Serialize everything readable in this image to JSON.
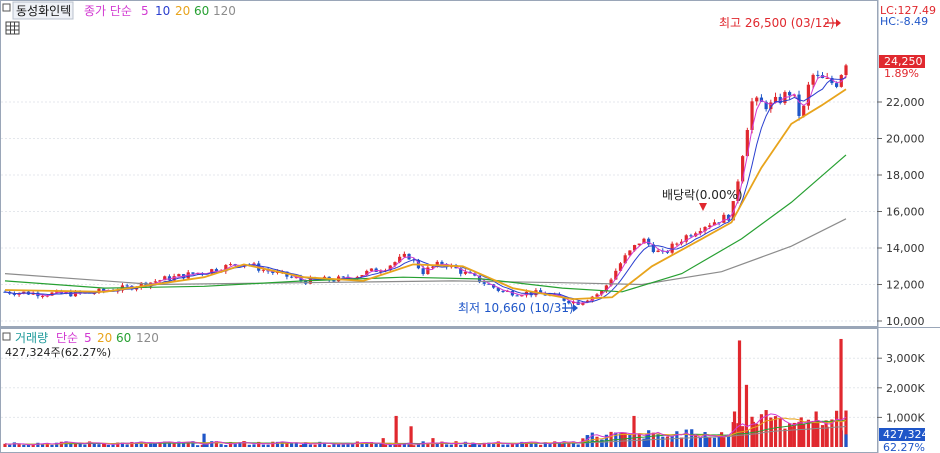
{
  "price_panel": {
    "stock_name": "동성화인텍",
    "indicator_label": "종가 단순",
    "ma_labels": [
      "5",
      "10",
      "20",
      "60",
      "120"
    ],
    "lc_text": "LC:127.49",
    "hc_text": "HC:-8.49",
    "high_annotation": "최고 26,500 (03/12)",
    "low_annotation": "최저 10,660 (10/31)",
    "dividend_annotation": "배당락(0.00%)",
    "current_price": "24,250",
    "change_pct": "1.89%"
  },
  "volume_panel": {
    "title": "거래량",
    "indicator_label": "단순",
    "ma_labels": [
      "5",
      "20",
      "60",
      "120"
    ],
    "volume_info": "427,324주(62.27%)",
    "current_volume": "427,324",
    "current_pct": "62.27%"
  },
  "colors": {
    "up": "#e0282e",
    "down": "#1f56c8",
    "ma5": "#d23ad2",
    "ma10": "#2a3fd0",
    "ma20": "#e8a41c",
    "ma60": "#27a032",
    "ma120": "#8c8c8c"
  },
  "chart_data": [
    {
      "type": "line",
      "title": "동성화인텍",
      "ylim": [
        10000,
        26500
      ],
      "y_ticks": [
        "10,000",
        "12,000",
        "14,000",
        "16,000",
        "18,000",
        "20,000",
        "22,000"
      ],
      "series": [
        {
          "name": "종가",
          "points": [
            [
              0,
              11600
            ],
            [
              40,
              11500
            ],
            [
              80,
              11500
            ],
            [
              120,
              11800
            ],
            [
              160,
              12300
            ],
            [
              200,
              12700
            ],
            [
              240,
              13200
            ],
            [
              260,
              12800
            ],
            [
              300,
              12200
            ],
            [
              340,
              12300
            ],
            [
              380,
              12900
            ],
            [
              405,
              13600
            ],
            [
              420,
              12700
            ],
            [
              440,
              13200
            ],
            [
              470,
              12400
            ],
            [
              500,
              11600
            ],
            [
              540,
              11500
            ],
            [
              575,
              11000
            ],
            [
              600,
              11600
            ],
            [
              620,
              13300
            ],
            [
              640,
              14500
            ],
            [
              660,
              13600
            ],
            [
              680,
              14500
            ],
            [
              700,
              15200
            ],
            [
              730,
              15800
            ],
            [
              750,
              22000
            ],
            [
              770,
              21800
            ],
            [
              790,
              22600
            ],
            [
              800,
              21000
            ],
            [
              810,
              23500
            ],
            [
              820,
              23200
            ],
            [
              835,
              23000
            ],
            [
              845,
              24250
            ]
          ]
        },
        {
          "name": "5",
          "points": []
        },
        {
          "name": "10",
          "points": []
        },
        {
          "name": "20",
          "points": [
            [
              0,
              11700
            ],
            [
              100,
              11600
            ],
            [
              200,
              12400
            ],
            [
              240,
              13100
            ],
            [
              300,
              12400
            ],
            [
              360,
              12200
            ],
            [
              410,
              13100
            ],
            [
              460,
              13000
            ],
            [
              510,
              11800
            ],
            [
              570,
              11200
            ],
            [
              610,
              11300
            ],
            [
              650,
              13000
            ],
            [
              700,
              14500
            ],
            [
              730,
              15400
            ],
            [
              760,
              18400
            ],
            [
              790,
              20800
            ],
            [
              820,
              21800
            ],
            [
              845,
              22700
            ]
          ]
        },
        {
          "name": "60",
          "points": [
            [
              0,
              12200
            ],
            [
              100,
              11800
            ],
            [
              200,
              11900
            ],
            [
              300,
              12200
            ],
            [
              400,
              12400
            ],
            [
              480,
              12300
            ],
            [
              560,
              11800
            ],
            [
              620,
              11600
            ],
            [
              680,
              12600
            ],
            [
              740,
              14500
            ],
            [
              790,
              16500
            ],
            [
              845,
              19100
            ]
          ]
        },
        {
          "name": "120",
          "points": [
            [
              0,
              12600
            ],
            [
              150,
              12000
            ],
            [
              300,
              12100
            ],
            [
              450,
              12200
            ],
            [
              560,
              12100
            ],
            [
              640,
              12000
            ],
            [
              720,
              12700
            ],
            [
              790,
              14100
            ],
            [
              845,
              15600
            ]
          ]
        }
      ]
    },
    {
      "type": "bar",
      "title": "거래량",
      "ylim": [
        0,
        3700
      ],
      "y_ticks": [
        "1,000K",
        "2,000K",
        "3,000K"
      ],
      "series": [
        {
          "name": "거래량",
          "points": [
            [
              100,
              100
            ],
            [
              150,
              150
            ],
            [
              200,
              450
            ],
            [
              240,
              200
            ],
            [
              300,
              100
            ],
            [
              340,
              80
            ],
            [
              380,
              300
            ],
            [
              393,
              1050
            ],
            [
              408,
              700
            ],
            [
              430,
              300
            ],
            [
              470,
              150
            ],
            [
              520,
              120
            ],
            [
              560,
              100
            ],
            [
              585,
              400
            ],
            [
              600,
              250
            ],
            [
              620,
              500
            ],
            [
              632,
              1050
            ],
            [
              645,
              450
            ],
            [
              670,
              180
            ],
            [
              690,
              600
            ],
            [
              705,
              350
            ],
            [
              720,
              500
            ],
            [
              733,
              1200
            ],
            [
              738,
              3600
            ],
            [
              745,
              2100
            ],
            [
              752,
              850
            ],
            [
              770,
              900
            ],
            [
              790,
              700
            ],
            [
              800,
              1000
            ],
            [
              815,
              1200
            ],
            [
              825,
              900
            ],
            [
              840,
              3650
            ],
            [
              845,
              427
            ]
          ]
        }
      ]
    }
  ]
}
